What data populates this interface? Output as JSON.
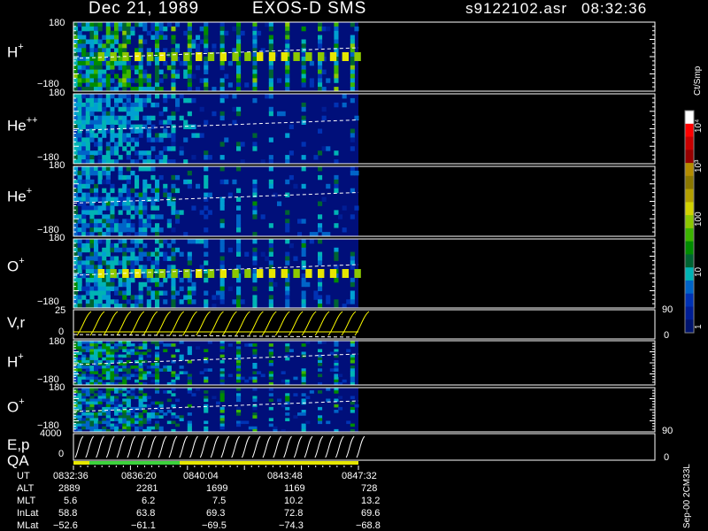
{
  "header": {
    "date": "Dec 21, 1989",
    "mission": "EXOS-D SMS",
    "file": "s9122102.asr",
    "time": "08:32:36"
  },
  "panels": [
    {
      "id": "h_plus",
      "label": "H",
      "sup": "+",
      "top": "180",
      "bottom": "−180"
    },
    {
      "id": "he_pp",
      "label": "He",
      "sup": "++",
      "top": "180",
      "bottom": "−180"
    },
    {
      "id": "he_plus",
      "label": "He",
      "sup": "+",
      "top": "180",
      "bottom": "−180"
    },
    {
      "id": "o_plus",
      "label": "O",
      "sup": "+",
      "top": "180",
      "bottom": "−180"
    },
    {
      "id": "vr",
      "label": "V,r",
      "sup": "",
      "top": "25",
      "bottom": "0",
      "right_top": "90",
      "right_bottom": "0"
    },
    {
      "id": "h_plus_2",
      "label": "H",
      "sup": "+",
      "top": "180",
      "bottom": "−180"
    },
    {
      "id": "o_plus_2",
      "label": "O",
      "sup": "+",
      "top": "180",
      "bottom": "−180"
    },
    {
      "id": "ep",
      "label": "E,p",
      "sup": "",
      "label2": "QA",
      "top": "4000",
      "bottom": "0",
      "right_top": "90",
      "right_bottom": "0"
    }
  ],
  "colorbar": {
    "unit": "Ct/Smp",
    "tick_labels": [
      "10⁴",
      "10³",
      "100",
      "10",
      "1"
    ],
    "colors": [
      "#ffffff",
      "#ff0000",
      "#c80000",
      "#960000",
      "#b48c00",
      "#8c7800",
      "#b4a000",
      "#d2d200",
      "#8cc800",
      "#3cb400",
      "#008c00",
      "#006432",
      "#00b4b4",
      "#0064c8",
      "#0032b4",
      "#001e96",
      "#00146e"
    ]
  },
  "footer": {
    "version": "Sep-00 2CM33L",
    "ephemeris": {
      "rows": [
        "UT",
        "ALT",
        "MLT",
        "InLat",
        "MLat"
      ],
      "columns": [
        [
          "0832:36",
          "2889",
          "5.6",
          "58.8",
          "−52.6"
        ],
        [
          "0836:20",
          "2281",
          "6.2",
          "63.8",
          "−61.1"
        ],
        [
          "0840:04",
          "1699",
          "7.5",
          "69.3",
          "−69.5"
        ],
        [
          "0843:48",
          "1169",
          "10.2",
          "72.8",
          "−74.3"
        ],
        [
          "0847:32",
          "728",
          "13.2",
          "69.6",
          "−68.8"
        ]
      ]
    }
  },
  "chart_data": {
    "type": "heatmap",
    "title": "Dec 21, 1989   EXOS-D SMS",
    "x_axis": {
      "label": "UT",
      "ticks": [
        "0832:36",
        "0836:20",
        "0840:04",
        "0843:48",
        "0847:32"
      ]
    },
    "color_scale": {
      "unit": "Ct/Smp",
      "log": true,
      "range": [
        1,
        10000
      ]
    },
    "data_coverage_fraction": 0.49,
    "spectrogram_panels": [
      "H+",
      "He++",
      "He+",
      "O+",
      "H+",
      "O+"
    ],
    "line_panels": [
      "V,r",
      "E,p"
    ],
    "quality_bar": {
      "label": "QA",
      "segments": [
        "yellow",
        "green",
        "yellow"
      ]
    }
  }
}
